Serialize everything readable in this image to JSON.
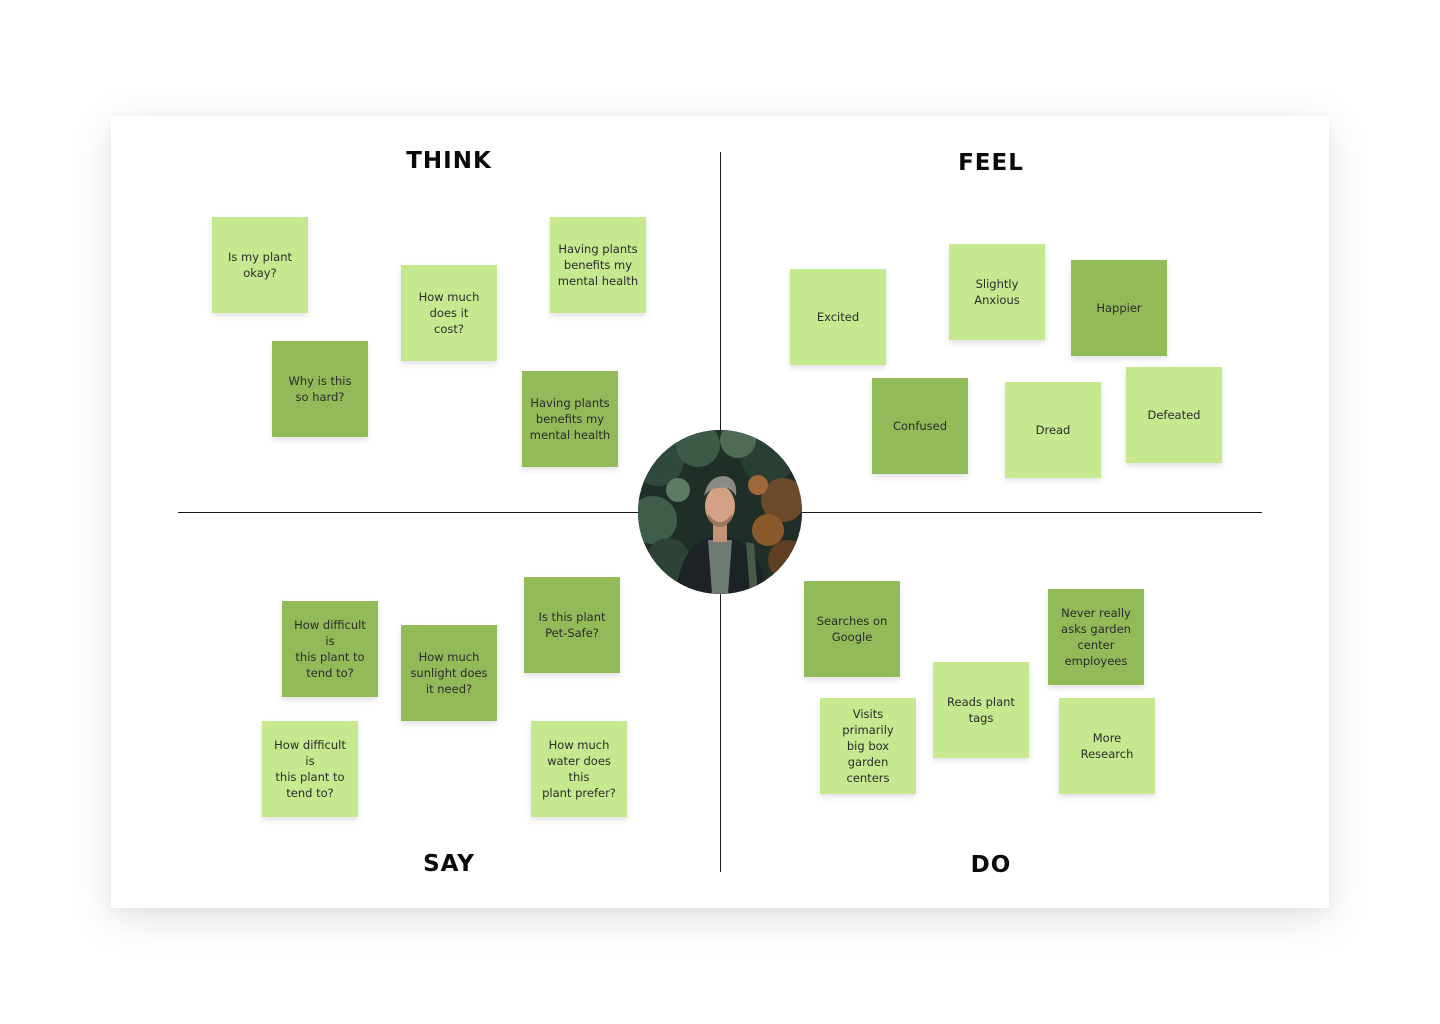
{
  "quadrants": {
    "think": {
      "title": "THINK"
    },
    "feel": {
      "title": "FEEL"
    },
    "say": {
      "title": "SAY"
    },
    "do": {
      "title": "DO"
    }
  },
  "notes": {
    "think": [
      {
        "text": "Is my plant\nokay?",
        "tone": "light"
      },
      {
        "text": "How much\ndoes it\ncost?",
        "tone": "light"
      },
      {
        "text": "Having plants\nbenefits my\nmental health",
        "tone": "light"
      },
      {
        "text": "Why is this\nso hard?",
        "tone": "dark"
      },
      {
        "text": "Having plants\nbenefits my\nmental health",
        "tone": "dark"
      }
    ],
    "feel": [
      {
        "text": "Excited",
        "tone": "light"
      },
      {
        "text": "Slightly\nAnxious",
        "tone": "light"
      },
      {
        "text": "Happier",
        "tone": "dark"
      },
      {
        "text": "Confused",
        "tone": "dark"
      },
      {
        "text": "Dread",
        "tone": "light"
      },
      {
        "text": "Defeated",
        "tone": "light"
      }
    ],
    "say": [
      {
        "text": "How difficult is\nthis plant to\ntend to?",
        "tone": "dark"
      },
      {
        "text": "How much\nsunlight does\nit need?",
        "tone": "dark"
      },
      {
        "text": "Is this plant\nPet-Safe?",
        "tone": "dark"
      },
      {
        "text": "How difficult is\nthis plant to\ntend to?",
        "tone": "light"
      },
      {
        "text": "How much\nwater does this\nplant prefer?",
        "tone": "light"
      }
    ],
    "do": [
      {
        "text": "Searches on\nGoogle",
        "tone": "dark"
      },
      {
        "text": "Never really\nasks garden\ncenter\nemployees",
        "tone": "dark"
      },
      {
        "text": "Reads plant\ntags",
        "tone": "light"
      },
      {
        "text": "Visits primarily\nbig box garden\ncenters",
        "tone": "light"
      },
      {
        "text": "More\nResearch",
        "tone": "light"
      }
    ]
  },
  "colors": {
    "note_light": "#c6e98f",
    "note_dark": "#93ba59",
    "axis": "#1a1a1a"
  }
}
